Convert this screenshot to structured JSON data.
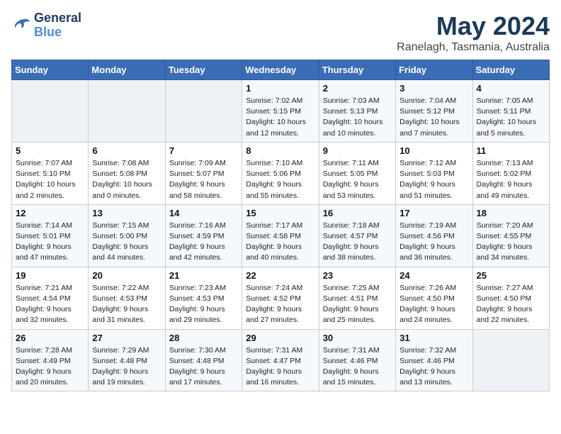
{
  "logo": {
    "line1": "General",
    "line2": "Blue"
  },
  "title": "May 2024",
  "location": "Ranelagh, Tasmania, Australia",
  "days_header": [
    "Sunday",
    "Monday",
    "Tuesday",
    "Wednesday",
    "Thursday",
    "Friday",
    "Saturday"
  ],
  "weeks": [
    [
      {
        "day": "",
        "info": ""
      },
      {
        "day": "",
        "info": ""
      },
      {
        "day": "",
        "info": ""
      },
      {
        "day": "1",
        "info": "Sunrise: 7:02 AM\nSunset: 5:15 PM\nDaylight: 10 hours\nand 12 minutes."
      },
      {
        "day": "2",
        "info": "Sunrise: 7:03 AM\nSunset: 5:13 PM\nDaylight: 10 hours\nand 10 minutes."
      },
      {
        "day": "3",
        "info": "Sunrise: 7:04 AM\nSunset: 5:12 PM\nDaylight: 10 hours\nand 7 minutes."
      },
      {
        "day": "4",
        "info": "Sunrise: 7:05 AM\nSunset: 5:11 PM\nDaylight: 10 hours\nand 5 minutes."
      }
    ],
    [
      {
        "day": "5",
        "info": "Sunrise: 7:07 AM\nSunset: 5:10 PM\nDaylight: 10 hours\nand 2 minutes."
      },
      {
        "day": "6",
        "info": "Sunrise: 7:08 AM\nSunset: 5:08 PM\nDaylight: 10 hours\nand 0 minutes."
      },
      {
        "day": "7",
        "info": "Sunrise: 7:09 AM\nSunset: 5:07 PM\nDaylight: 9 hours\nand 58 minutes."
      },
      {
        "day": "8",
        "info": "Sunrise: 7:10 AM\nSunset: 5:06 PM\nDaylight: 9 hours\nand 55 minutes."
      },
      {
        "day": "9",
        "info": "Sunrise: 7:11 AM\nSunset: 5:05 PM\nDaylight: 9 hours\nand 53 minutes."
      },
      {
        "day": "10",
        "info": "Sunrise: 7:12 AM\nSunset: 5:03 PM\nDaylight: 9 hours\nand 51 minutes."
      },
      {
        "day": "11",
        "info": "Sunrise: 7:13 AM\nSunset: 5:02 PM\nDaylight: 9 hours\nand 49 minutes."
      }
    ],
    [
      {
        "day": "12",
        "info": "Sunrise: 7:14 AM\nSunset: 5:01 PM\nDaylight: 9 hours\nand 47 minutes."
      },
      {
        "day": "13",
        "info": "Sunrise: 7:15 AM\nSunset: 5:00 PM\nDaylight: 9 hours\nand 44 minutes."
      },
      {
        "day": "14",
        "info": "Sunrise: 7:16 AM\nSunset: 4:59 PM\nDaylight: 9 hours\nand 42 minutes."
      },
      {
        "day": "15",
        "info": "Sunrise: 7:17 AM\nSunset: 4:58 PM\nDaylight: 9 hours\nand 40 minutes."
      },
      {
        "day": "16",
        "info": "Sunrise: 7:18 AM\nSunset: 4:57 PM\nDaylight: 9 hours\nand 38 minutes."
      },
      {
        "day": "17",
        "info": "Sunrise: 7:19 AM\nSunset: 4:56 PM\nDaylight: 9 hours\nand 36 minutes."
      },
      {
        "day": "18",
        "info": "Sunrise: 7:20 AM\nSunset: 4:55 PM\nDaylight: 9 hours\nand 34 minutes."
      }
    ],
    [
      {
        "day": "19",
        "info": "Sunrise: 7:21 AM\nSunset: 4:54 PM\nDaylight: 9 hours\nand 32 minutes."
      },
      {
        "day": "20",
        "info": "Sunrise: 7:22 AM\nSunset: 4:53 PM\nDaylight: 9 hours\nand 31 minutes."
      },
      {
        "day": "21",
        "info": "Sunrise: 7:23 AM\nSunset: 4:53 PM\nDaylight: 9 hours\nand 29 minutes."
      },
      {
        "day": "22",
        "info": "Sunrise: 7:24 AM\nSunset: 4:52 PM\nDaylight: 9 hours\nand 27 minutes."
      },
      {
        "day": "23",
        "info": "Sunrise: 7:25 AM\nSunset: 4:51 PM\nDaylight: 9 hours\nand 25 minutes."
      },
      {
        "day": "24",
        "info": "Sunrise: 7:26 AM\nSunset: 4:50 PM\nDaylight: 9 hours\nand 24 minutes."
      },
      {
        "day": "25",
        "info": "Sunrise: 7:27 AM\nSunset: 4:50 PM\nDaylight: 9 hours\nand 22 minutes."
      }
    ],
    [
      {
        "day": "26",
        "info": "Sunrise: 7:28 AM\nSunset: 4:49 PM\nDaylight: 9 hours\nand 20 minutes."
      },
      {
        "day": "27",
        "info": "Sunrise: 7:29 AM\nSunset: 4:48 PM\nDaylight: 9 hours\nand 19 minutes."
      },
      {
        "day": "28",
        "info": "Sunrise: 7:30 AM\nSunset: 4:48 PM\nDaylight: 9 hours\nand 17 minutes."
      },
      {
        "day": "29",
        "info": "Sunrise: 7:31 AM\nSunset: 4:47 PM\nDaylight: 9 hours\nand 16 minutes."
      },
      {
        "day": "30",
        "info": "Sunrise: 7:31 AM\nSunset: 4:46 PM\nDaylight: 9 hours\nand 15 minutes."
      },
      {
        "day": "31",
        "info": "Sunrise: 7:32 AM\nSunset: 4:46 PM\nDaylight: 9 hours\nand 13 minutes."
      },
      {
        "day": "",
        "info": ""
      }
    ]
  ]
}
